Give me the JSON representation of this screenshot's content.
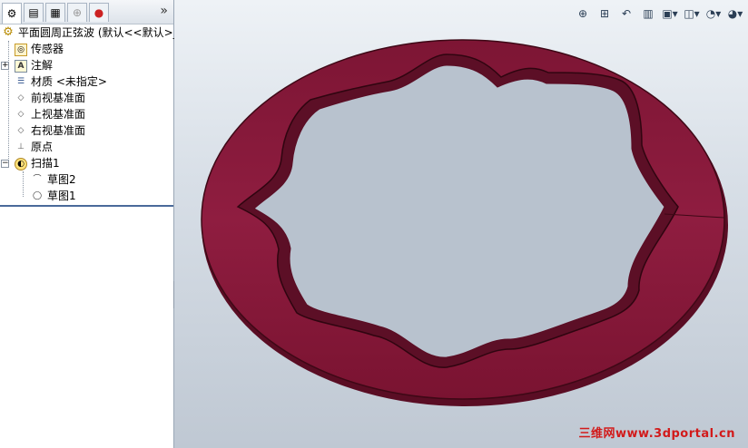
{
  "tabs": [
    {
      "icon": "feature-manager-icon"
    },
    {
      "icon": "property-manager-icon"
    },
    {
      "icon": "configuration-manager-icon"
    },
    {
      "icon": "dimxpert-manager-icon"
    },
    {
      "icon": "display-manager-icon"
    }
  ],
  "tabs_more": "»",
  "tree": {
    "root": "平面圆周正弦波   (默认<<默认>_",
    "items": [
      {
        "label": "传感器",
        "icon": "sensor-icon"
      },
      {
        "label": "注解",
        "icon": "annotation-icon"
      },
      {
        "label": "材质 <未指定>",
        "icon": "material-icon"
      },
      {
        "label": "前视基准面",
        "icon": "plane-icon"
      },
      {
        "label": "上视基准面",
        "icon": "plane-icon"
      },
      {
        "label": "右视基准面",
        "icon": "plane-icon"
      },
      {
        "label": "原点",
        "icon": "origin-icon"
      },
      {
        "label": "扫描1",
        "icon": "sweep-icon"
      },
      {
        "label": "草图2",
        "icon": "sketch-icon"
      },
      {
        "label": "草图1",
        "icon": "sketch-icon"
      }
    ]
  },
  "toolbar": [
    "zoom-to-fit-icon",
    "zoom-area-icon",
    "previous-view-icon",
    "section-view-icon",
    "view-orientation-icon",
    "display-style-icon",
    "hide-show-icon",
    "appearance-icon"
  ],
  "watermark": "三维网www.3dportal.cn",
  "colors": {
    "part": "#8a1b3b",
    "part_edge": "#4a0a1e",
    "part_highlight": "#b42a55"
  }
}
